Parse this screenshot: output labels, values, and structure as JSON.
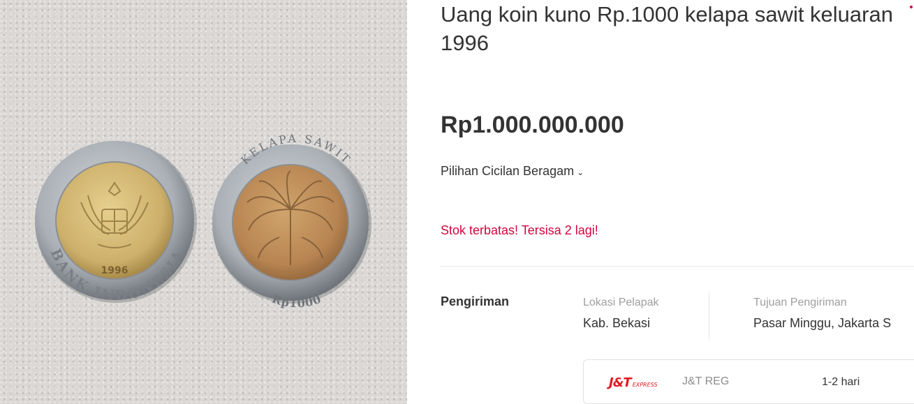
{
  "product": {
    "title": "Uang koin kuno Rp.1000 kelapa sawit keluaran 1996",
    "price": "Rp1.000.000.000",
    "installment_label": "Pilihan Cicilan Beragam",
    "stock_notice": "Stok terbatas! Tersisa 2 lagi!"
  },
  "photo": {
    "coin_left_ring_text": "BANK INDONESIA",
    "coin_left_year": "1996",
    "coin_right_ring_text": "KELAPA SAWIT",
    "coin_right_value": "Rp1000"
  },
  "shipping": {
    "section_label": "Pengiriman",
    "origin_caption": "Lokasi Pelapak",
    "origin_value": "Kab. Bekasi",
    "destination_caption": "Tujuan Pengiriman",
    "destination_value": "Pasar Minggu, Jakarta S",
    "courier": {
      "logo_main": "J&T",
      "logo_sub": "EXPRESS",
      "service": "J&T REG",
      "eta": "1-2 hari"
    }
  },
  "colors": {
    "accent": "#d0053d",
    "text": "#333333",
    "muted": "#9e9e9e",
    "courier_brand": "#e21b23"
  },
  "icons": {
    "installment_chevron": "chevron-down-icon"
  }
}
